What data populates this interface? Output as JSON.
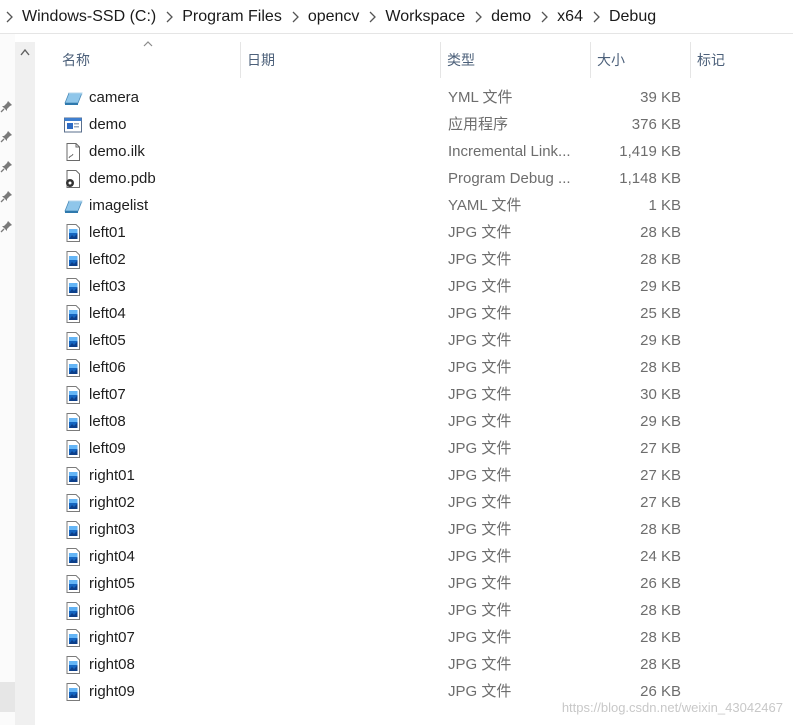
{
  "breadcrumb": [
    "Windows-SSD (C:)",
    "Program Files",
    "opencv",
    "Workspace",
    "demo",
    "x64",
    "Debug"
  ],
  "columns": {
    "name": "名称",
    "date": "日期",
    "type": "类型",
    "size": "大小",
    "tags": "标记"
  },
  "files": [
    {
      "name": "camera",
      "type": "YML 文件",
      "size": "39 KB",
      "icon": "yml-file-icon"
    },
    {
      "name": "demo",
      "type": "应用程序",
      "size": "376 KB",
      "icon": "application-icon"
    },
    {
      "name": "demo.ilk",
      "type": "Incremental Link...",
      "size": "1,419 KB",
      "icon": "ilk-file-icon"
    },
    {
      "name": "demo.pdb",
      "type": "Program Debug ...",
      "size": "1,148 KB",
      "icon": "pdb-file-icon"
    },
    {
      "name": "imagelist",
      "type": "YAML 文件",
      "size": "1 KB",
      "icon": "yaml-file-icon"
    },
    {
      "name": "left01",
      "type": "JPG 文件",
      "size": "28 KB",
      "icon": "jpg-image-icon"
    },
    {
      "name": "left02",
      "type": "JPG 文件",
      "size": "28 KB",
      "icon": "jpg-image-icon"
    },
    {
      "name": "left03",
      "type": "JPG 文件",
      "size": "29 KB",
      "icon": "jpg-image-icon"
    },
    {
      "name": "left04",
      "type": "JPG 文件",
      "size": "25 KB",
      "icon": "jpg-image-icon"
    },
    {
      "name": "left05",
      "type": "JPG 文件",
      "size": "29 KB",
      "icon": "jpg-image-icon"
    },
    {
      "name": "left06",
      "type": "JPG 文件",
      "size": "28 KB",
      "icon": "jpg-image-icon"
    },
    {
      "name": "left07",
      "type": "JPG 文件",
      "size": "30 KB",
      "icon": "jpg-image-icon"
    },
    {
      "name": "left08",
      "type": "JPG 文件",
      "size": "29 KB",
      "icon": "jpg-image-icon"
    },
    {
      "name": "left09",
      "type": "JPG 文件",
      "size": "27 KB",
      "icon": "jpg-image-icon"
    },
    {
      "name": "right01",
      "type": "JPG 文件",
      "size": "27 KB",
      "icon": "jpg-image-icon"
    },
    {
      "name": "right02",
      "type": "JPG 文件",
      "size": "27 KB",
      "icon": "jpg-image-icon"
    },
    {
      "name": "right03",
      "type": "JPG 文件",
      "size": "28 KB",
      "icon": "jpg-image-icon"
    },
    {
      "name": "right04",
      "type": "JPG 文件",
      "size": "24 KB",
      "icon": "jpg-image-icon"
    },
    {
      "name": "right05",
      "type": "JPG 文件",
      "size": "26 KB",
      "icon": "jpg-image-icon"
    },
    {
      "name": "right06",
      "type": "JPG 文件",
      "size": "28 KB",
      "icon": "jpg-image-icon"
    },
    {
      "name": "right07",
      "type": "JPG 文件",
      "size": "28 KB",
      "icon": "jpg-image-icon"
    },
    {
      "name": "right08",
      "type": "JPG 文件",
      "size": "28 KB",
      "icon": "jpg-image-icon"
    },
    {
      "name": "right09",
      "type": "JPG 文件",
      "size": "26 KB",
      "icon": "jpg-image-icon"
    }
  ],
  "watermark": "https://blog.csdn.net/weixin_43042467",
  "colors": {
    "header_text": "#4c607a",
    "secondary_text": "#6d6d6d",
    "accent_blue": "#1565c0"
  }
}
